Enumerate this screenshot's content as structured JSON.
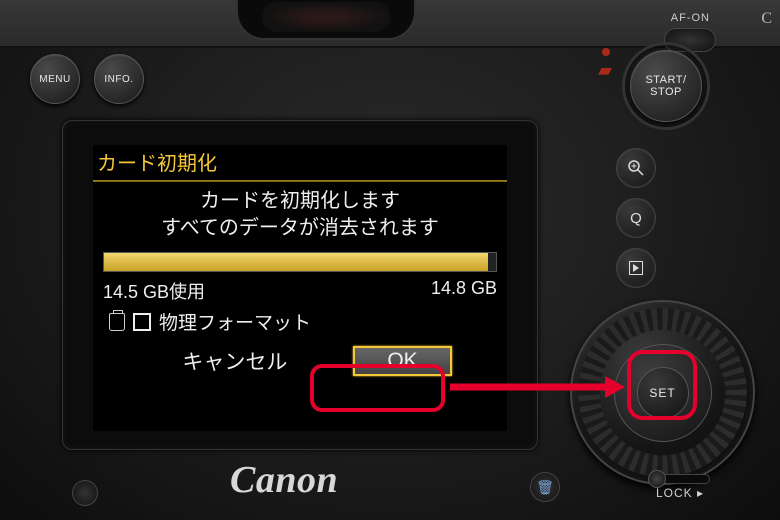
{
  "camera": {
    "brand": "Canon",
    "af_on_label": "AF-ON",
    "buttons": {
      "menu": "MENU",
      "info": "INFO.",
      "start_stop": "START/\nSTOP",
      "q": "Q",
      "set": "SET",
      "lock": "LOCK ▸"
    }
  },
  "screen": {
    "title": "カード初期化",
    "line1": "カードを初期化します",
    "line2": "すべてのデータが消去されます",
    "used_label": "14.5 GB使用",
    "total_label": "14.8 GB",
    "used_gb": 14.5,
    "total_gb": 14.8,
    "low_level_label": "物理フォーマット",
    "low_level_checked": false,
    "cancel_label": "キャンセル",
    "ok_label": "OK",
    "selected": "ok"
  }
}
